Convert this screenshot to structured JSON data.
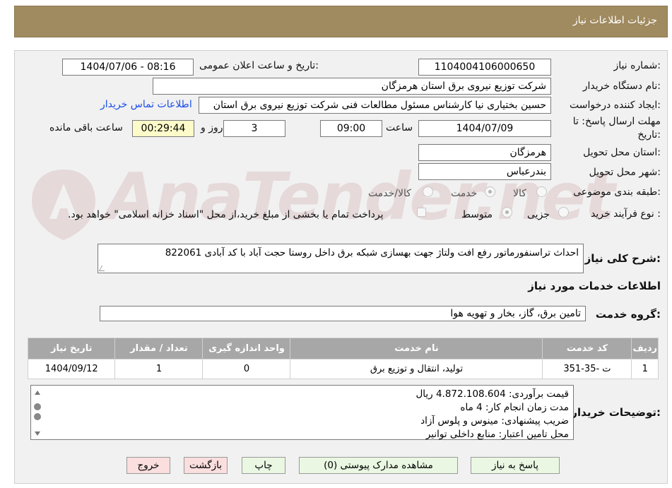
{
  "header": {
    "title": "جزئیات اطلاعات نیاز"
  },
  "watermark": {
    "text": "AnaTender.net"
  },
  "fields": {
    "need_number_label": "شماره نیاز:",
    "need_number": "1104004106000650",
    "announce_label": "تاریخ و ساعت اعلان عمومی:",
    "announce_value": "1404/07/06 - 08:16",
    "buyer_org_label": "نام دستگاه خریدار:",
    "buyer_org": "شرکت توزیع نیروی برق استان هرمزگان",
    "requester_label": "ایجاد کننده درخواست:",
    "requester": "حسین بختیاری نیا کارشناس مسئول مطالعات فنی شرکت توزیع نیروی برق استان",
    "buyer_contact_link": "اطلاعات تماس خریدار",
    "deadline_label_1": "مهلت ارسال پاسخ: تا",
    "deadline_label_2": "تاریخ:",
    "deadline_date": "1404/07/09",
    "time_label": "ساعت",
    "deadline_time": "09:00",
    "days_value": "3",
    "days_label": "روز و",
    "remaining_time": "00:29:44",
    "remaining_label": "ساعت باقی مانده",
    "province_label": "استان محل تحویل:",
    "province": "هرمزگان",
    "city_label": "شهر محل تحویل:",
    "city": "بندرعباس",
    "category_label": "طبقه بندی موضوعی:",
    "category_options": [
      "کالا",
      "خدمت",
      "کالا/خدمت"
    ],
    "category_selected": "خدمت",
    "process_label": "نوع فرآیند خرید :",
    "process_options": [
      "جزیی",
      "متوسط"
    ],
    "process_selected": "متوسط",
    "payment_note": "پرداخت تمام یا بخشی از مبلغ خرید،از محل \"اسناد خزانه اسلامی\" خواهد بود.",
    "summary_label": "شرح کلی نیاز:",
    "summary": "احداث تراسنفورماتور رفع افت ولتاژ جهت بهسازی شبکه برق داخل روستا حجت آباد با کد آبادی 822061",
    "services_title": "اطلاعات خدمات مورد نیاز",
    "service_group_label": "گروه خدمت:",
    "service_group": "تامین برق، گاز، بخار و تهویه هوا"
  },
  "table": {
    "headers": [
      "ردیف",
      "کد خدمت",
      "نام خدمت",
      "واحد اندازه گیری",
      "تعداد / مقدار",
      "تاریخ نیاز"
    ],
    "rows": [
      [
        "1",
        "ت -35-351",
        "تولید، انتقال و توزیع برق",
        "0",
        "1",
        "1404/09/12"
      ]
    ]
  },
  "notes": {
    "label": "توضیحات خریدار:",
    "lines": [
      "قیمت برآوردی:  4.872.108.604 ریال",
      "مدت زمان انجام کار: 4 ماه",
      "ضریب پیشنهادی: مینوس و پلوس آزاد",
      "محل تامین اعتبار: منابع داخلی توانیر"
    ]
  },
  "buttons": {
    "respond": "پاسخ به نیاز",
    "attachments": "مشاهده مدارک پیوستی (0)",
    "print": "چاپ",
    "back": "بازگشت",
    "exit": "خروج"
  }
}
